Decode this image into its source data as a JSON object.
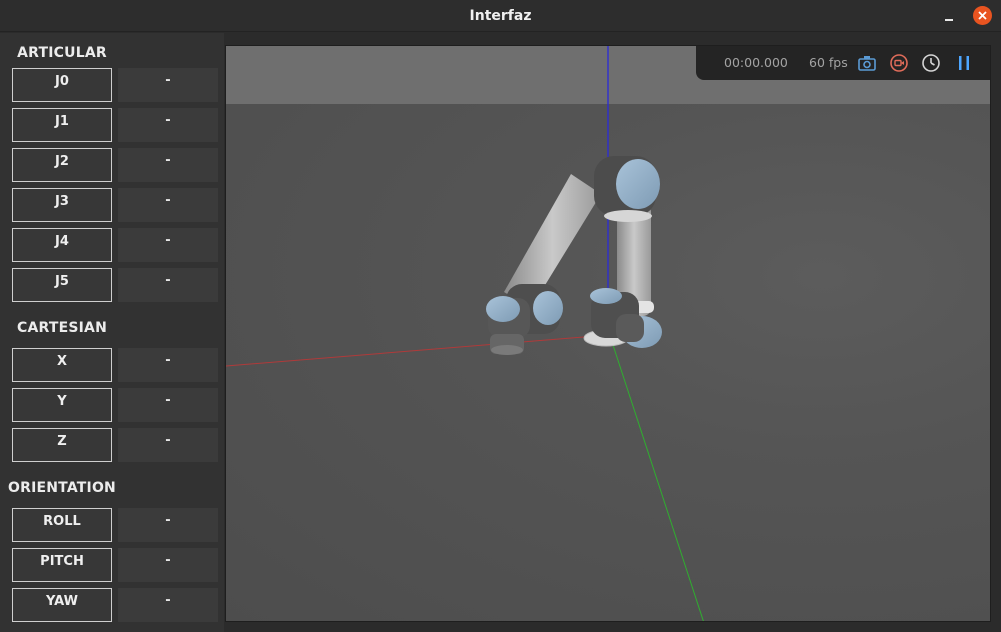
{
  "window": {
    "title": "Interfaz"
  },
  "sections": {
    "articular": "ARTICULAR",
    "cartesian": "CARTESIAN",
    "orientation": "ORIENTATION"
  },
  "articular": [
    {
      "label": "J0",
      "value": "-"
    },
    {
      "label": "J1",
      "value": "-"
    },
    {
      "label": "J2",
      "value": "-"
    },
    {
      "label": "J3",
      "value": "-"
    },
    {
      "label": "J4",
      "value": "-"
    },
    {
      "label": "J5",
      "value": "-"
    }
  ],
  "cartesian": [
    {
      "label": "X",
      "value": "-"
    },
    {
      "label": "Y",
      "value": "-"
    },
    {
      "label": "Z",
      "value": "-"
    }
  ],
  "orientation": [
    {
      "label": "ROLL",
      "value": "-"
    },
    {
      "label": "PITCH",
      "value": "-"
    },
    {
      "label": "YAW",
      "value": "-"
    }
  ],
  "viewer": {
    "time": "00:00.000",
    "fps": "60 fps",
    "icons": [
      "camera-icon",
      "record-icon",
      "clock-icon",
      "pause-icon"
    ],
    "colors": {
      "camera": "#5b9bd5",
      "record": "#e06c5a",
      "clock": "#d6d6d6",
      "pause": "#4da6ff",
      "x_axis": "#b03a3a",
      "y_axis": "#2fae2f",
      "z_axis": "#2b2bd8"
    }
  }
}
